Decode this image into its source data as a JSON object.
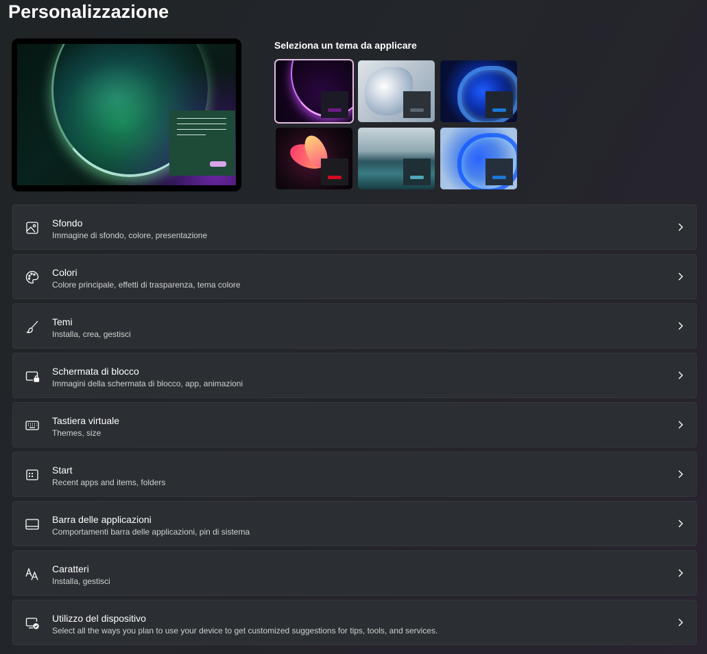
{
  "page": {
    "title": "Personalizzazione"
  },
  "themes": {
    "label": "Seleziona un tema da applicare",
    "items": [
      {
        "name": "dark-purple-theme",
        "accent": "#6b1a85",
        "selected": true
      },
      {
        "name": "light-bloom-theme",
        "accent": "#5b6670",
        "selected": false
      },
      {
        "name": "windows-dark-theme",
        "accent": "#1b78d4",
        "selected": false
      },
      {
        "name": "flower-theme",
        "accent": "#d40d1f",
        "selected": false
      },
      {
        "name": "lake-theme",
        "accent": "#4fa7b8",
        "selected": false
      },
      {
        "name": "windows-light-theme",
        "accent": "#1b78d4",
        "selected": false
      }
    ]
  },
  "settings": [
    {
      "icon": "image-icon",
      "title": "Sfondo",
      "subtitle": "Immagine di sfondo, colore, presentazione"
    },
    {
      "icon": "palette-icon",
      "title": "Colori",
      "subtitle": "Colore principale, effetti di trasparenza, tema colore"
    },
    {
      "icon": "brush-icon",
      "title": "Temi",
      "subtitle": "Installa, crea, gestisci"
    },
    {
      "icon": "lock-screen-icon",
      "title": "Schermata di blocco",
      "subtitle": "Immagini della schermata di blocco, app, animazioni"
    },
    {
      "icon": "keyboard-icon",
      "title": "Tastiera virtuale",
      "subtitle": "Themes, size"
    },
    {
      "icon": "start-menu-icon",
      "title": "Start",
      "subtitle": "Recent apps and items, folders"
    },
    {
      "icon": "taskbar-icon",
      "title": "Barra delle applicazioni",
      "subtitle": "Comportamenti barra delle applicazioni, pin di sistema"
    },
    {
      "icon": "fonts-icon",
      "title": "Caratteri",
      "subtitle": "Installa, gestisci"
    },
    {
      "icon": "device-usage-icon",
      "title": "Utilizzo del dispositivo",
      "subtitle": "Select all the ways you plan to use your device to get customized suggestions for tips, tools, and services."
    }
  ]
}
